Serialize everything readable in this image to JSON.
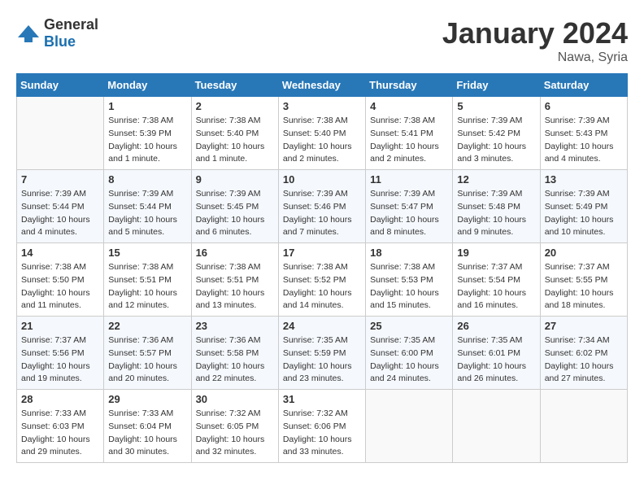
{
  "header": {
    "logo_general": "General",
    "logo_blue": "Blue",
    "month_title": "January 2024",
    "location": "Nawa, Syria"
  },
  "weekdays": [
    "Sunday",
    "Monday",
    "Tuesday",
    "Wednesday",
    "Thursday",
    "Friday",
    "Saturday"
  ],
  "weeks": [
    [
      {
        "day": "",
        "sunrise": "",
        "sunset": "",
        "daylight": ""
      },
      {
        "day": "1",
        "sunrise": "Sunrise: 7:38 AM",
        "sunset": "Sunset: 5:39 PM",
        "daylight": "Daylight: 10 hours and 1 minute."
      },
      {
        "day": "2",
        "sunrise": "Sunrise: 7:38 AM",
        "sunset": "Sunset: 5:40 PM",
        "daylight": "Daylight: 10 hours and 1 minute."
      },
      {
        "day": "3",
        "sunrise": "Sunrise: 7:38 AM",
        "sunset": "Sunset: 5:40 PM",
        "daylight": "Daylight: 10 hours and 2 minutes."
      },
      {
        "day": "4",
        "sunrise": "Sunrise: 7:38 AM",
        "sunset": "Sunset: 5:41 PM",
        "daylight": "Daylight: 10 hours and 2 minutes."
      },
      {
        "day": "5",
        "sunrise": "Sunrise: 7:39 AM",
        "sunset": "Sunset: 5:42 PM",
        "daylight": "Daylight: 10 hours and 3 minutes."
      },
      {
        "day": "6",
        "sunrise": "Sunrise: 7:39 AM",
        "sunset": "Sunset: 5:43 PM",
        "daylight": "Daylight: 10 hours and 4 minutes."
      }
    ],
    [
      {
        "day": "7",
        "sunrise": "Sunrise: 7:39 AM",
        "sunset": "Sunset: 5:44 PM",
        "daylight": "Daylight: 10 hours and 4 minutes."
      },
      {
        "day": "8",
        "sunrise": "Sunrise: 7:39 AM",
        "sunset": "Sunset: 5:44 PM",
        "daylight": "Daylight: 10 hours and 5 minutes."
      },
      {
        "day": "9",
        "sunrise": "Sunrise: 7:39 AM",
        "sunset": "Sunset: 5:45 PM",
        "daylight": "Daylight: 10 hours and 6 minutes."
      },
      {
        "day": "10",
        "sunrise": "Sunrise: 7:39 AM",
        "sunset": "Sunset: 5:46 PM",
        "daylight": "Daylight: 10 hours and 7 minutes."
      },
      {
        "day": "11",
        "sunrise": "Sunrise: 7:39 AM",
        "sunset": "Sunset: 5:47 PM",
        "daylight": "Daylight: 10 hours and 8 minutes."
      },
      {
        "day": "12",
        "sunrise": "Sunrise: 7:39 AM",
        "sunset": "Sunset: 5:48 PM",
        "daylight": "Daylight: 10 hours and 9 minutes."
      },
      {
        "day": "13",
        "sunrise": "Sunrise: 7:39 AM",
        "sunset": "Sunset: 5:49 PM",
        "daylight": "Daylight: 10 hours and 10 minutes."
      }
    ],
    [
      {
        "day": "14",
        "sunrise": "Sunrise: 7:38 AM",
        "sunset": "Sunset: 5:50 PM",
        "daylight": "Daylight: 10 hours and 11 minutes."
      },
      {
        "day": "15",
        "sunrise": "Sunrise: 7:38 AM",
        "sunset": "Sunset: 5:51 PM",
        "daylight": "Daylight: 10 hours and 12 minutes."
      },
      {
        "day": "16",
        "sunrise": "Sunrise: 7:38 AM",
        "sunset": "Sunset: 5:51 PM",
        "daylight": "Daylight: 10 hours and 13 minutes."
      },
      {
        "day": "17",
        "sunrise": "Sunrise: 7:38 AM",
        "sunset": "Sunset: 5:52 PM",
        "daylight": "Daylight: 10 hours and 14 minutes."
      },
      {
        "day": "18",
        "sunrise": "Sunrise: 7:38 AM",
        "sunset": "Sunset: 5:53 PM",
        "daylight": "Daylight: 10 hours and 15 minutes."
      },
      {
        "day": "19",
        "sunrise": "Sunrise: 7:37 AM",
        "sunset": "Sunset: 5:54 PM",
        "daylight": "Daylight: 10 hours and 16 minutes."
      },
      {
        "day": "20",
        "sunrise": "Sunrise: 7:37 AM",
        "sunset": "Sunset: 5:55 PM",
        "daylight": "Daylight: 10 hours and 18 minutes."
      }
    ],
    [
      {
        "day": "21",
        "sunrise": "Sunrise: 7:37 AM",
        "sunset": "Sunset: 5:56 PM",
        "daylight": "Daylight: 10 hours and 19 minutes."
      },
      {
        "day": "22",
        "sunrise": "Sunrise: 7:36 AM",
        "sunset": "Sunset: 5:57 PM",
        "daylight": "Daylight: 10 hours and 20 minutes."
      },
      {
        "day": "23",
        "sunrise": "Sunrise: 7:36 AM",
        "sunset": "Sunset: 5:58 PM",
        "daylight": "Daylight: 10 hours and 22 minutes."
      },
      {
        "day": "24",
        "sunrise": "Sunrise: 7:35 AM",
        "sunset": "Sunset: 5:59 PM",
        "daylight": "Daylight: 10 hours and 23 minutes."
      },
      {
        "day": "25",
        "sunrise": "Sunrise: 7:35 AM",
        "sunset": "Sunset: 6:00 PM",
        "daylight": "Daylight: 10 hours and 24 minutes."
      },
      {
        "day": "26",
        "sunrise": "Sunrise: 7:35 AM",
        "sunset": "Sunset: 6:01 PM",
        "daylight": "Daylight: 10 hours and 26 minutes."
      },
      {
        "day": "27",
        "sunrise": "Sunrise: 7:34 AM",
        "sunset": "Sunset: 6:02 PM",
        "daylight": "Daylight: 10 hours and 27 minutes."
      }
    ],
    [
      {
        "day": "28",
        "sunrise": "Sunrise: 7:33 AM",
        "sunset": "Sunset: 6:03 PM",
        "daylight": "Daylight: 10 hours and 29 minutes."
      },
      {
        "day": "29",
        "sunrise": "Sunrise: 7:33 AM",
        "sunset": "Sunset: 6:04 PM",
        "daylight": "Daylight: 10 hours and 30 minutes."
      },
      {
        "day": "30",
        "sunrise": "Sunrise: 7:32 AM",
        "sunset": "Sunset: 6:05 PM",
        "daylight": "Daylight: 10 hours and 32 minutes."
      },
      {
        "day": "31",
        "sunrise": "Sunrise: 7:32 AM",
        "sunset": "Sunset: 6:06 PM",
        "daylight": "Daylight: 10 hours and 33 minutes."
      },
      {
        "day": "",
        "sunrise": "",
        "sunset": "",
        "daylight": ""
      },
      {
        "day": "",
        "sunrise": "",
        "sunset": "",
        "daylight": ""
      },
      {
        "day": "",
        "sunrise": "",
        "sunset": "",
        "daylight": ""
      }
    ]
  ]
}
